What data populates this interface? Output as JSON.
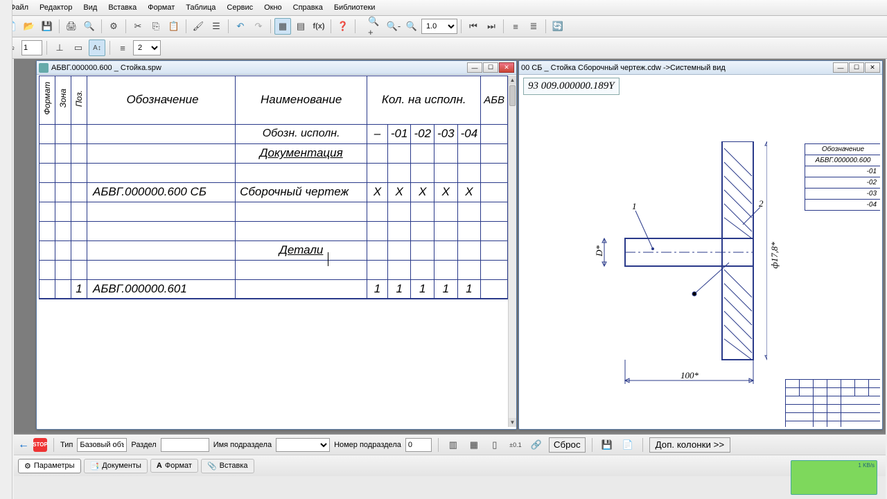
{
  "menu": [
    "Файл",
    "Редактор",
    "Вид",
    "Вставка",
    "Формат",
    "Таблица",
    "Сервис",
    "Окно",
    "Справка",
    "Библиотеки"
  ],
  "toolbar2": {
    "n1": "1",
    "n2": "2"
  },
  "zoom": "1.0",
  "win1": {
    "title": "АБВГ.000000.600 _ Стойка.spw",
    "headers": {
      "fmt": "Формат",
      "zone": "Зона",
      "pos": "Поз.",
      "des": "Обозначение",
      "name": "Наименование",
      "qty": "Кол. на исполн.",
      "note": "АБВ"
    },
    "sub_des": "Обозн. исполн.",
    "sub_q": [
      "–",
      "-01",
      "-02",
      "-03",
      "-04"
    ],
    "sec_doc": "Документация",
    "row_doc": {
      "des": "АБВГ.000000.600 СБ",
      "name": "Сборочный чертеж",
      "q": [
        "X",
        "X",
        "X",
        "X",
        "X"
      ]
    },
    "sec_det": "Детали",
    "row_det": {
      "pos": "1",
      "des": "АБВГ.000000.601",
      "q": [
        "1",
        "1",
        "1",
        "1",
        "1"
      ]
    }
  },
  "win2": {
    "title": "00 СБ _ Стойка Сборочный чертеж.cdw ->Системный вид",
    "dimbox": "93 009.000000.189Y",
    "bom_h": "Обозначение",
    "bom_rows": [
      "АБВГ.000000.600",
      "-01",
      "-02",
      "-03",
      "-04"
    ],
    "dim_d": "D*",
    "dim_phi": "ф17,8*",
    "dim_w": "100*",
    "lead1": "1",
    "lead2": "2"
  },
  "bottom": {
    "type_lbl": "Тип",
    "type_val": "Базовый объ",
    "razdel_lbl": "Раздел",
    "razdel_val": "",
    "podraz_lbl": "Имя подраздела",
    "podraz_val": "",
    "nom_lbl": "Номер подраздела",
    "nom_val": "0",
    "reset": "Сброс",
    "dopcol": "Доп. колонки   >>",
    "tabs": [
      "Параметры",
      "Документы",
      "Формат",
      "Вставка"
    ]
  },
  "preview": "1 KB/s"
}
